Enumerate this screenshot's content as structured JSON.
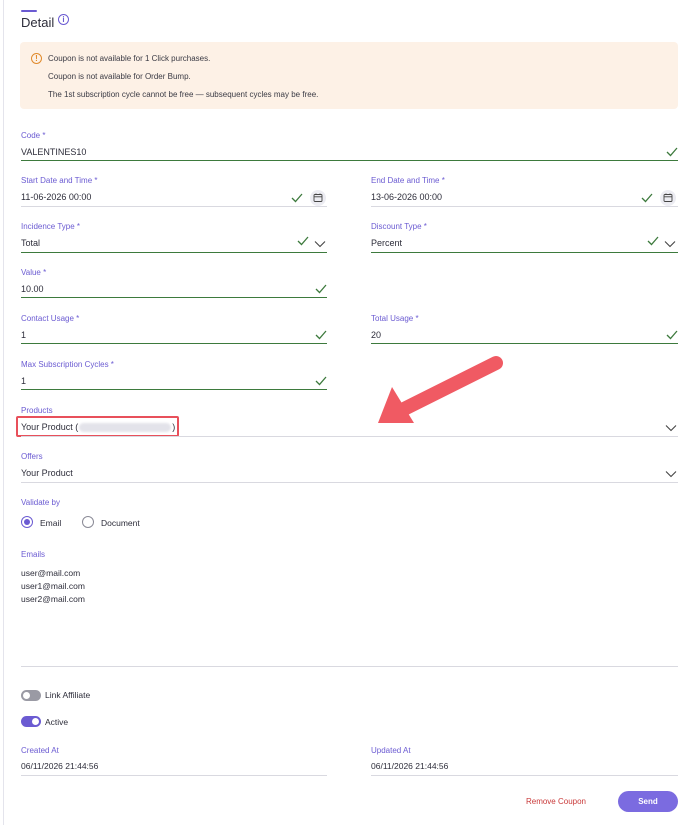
{
  "header": {
    "title": "Detail"
  },
  "alert": {
    "messages": [
      "Coupon is not available for 1 Click purchases.",
      "Coupon is not available for Order Bump.",
      "The 1st subscription cycle cannot be free — subsequent cycles may be free."
    ]
  },
  "form": {
    "code": {
      "label": "Code *",
      "value": "VALENTINES10"
    },
    "start": {
      "label": "Start Date and Time *",
      "value": "11-06-2026 00:00"
    },
    "end": {
      "label": "End Date and Time *",
      "value": "13-06-2026 00:00"
    },
    "incidence": {
      "label": "Incidence Type *",
      "value": "Total"
    },
    "discount": {
      "label": "Discount Type *",
      "value": "Percent"
    },
    "amount": {
      "label": "Value *",
      "value": "10.00"
    },
    "contact_usage": {
      "label": "Contact Usage *",
      "value": "1"
    },
    "total_usage": {
      "label": "Total Usage *",
      "value": "20"
    },
    "max_cycles": {
      "label": "Max Subscription Cycles *",
      "value": "1"
    },
    "products": {
      "label": "Products",
      "value_prefix": "Your Product (",
      "value_suffix": ")"
    },
    "offers": {
      "label": "Offers",
      "value": "Your Product"
    },
    "validate": {
      "label": "Validate by",
      "options": [
        "Email",
        "Document"
      ],
      "selected": "Email"
    },
    "emails": {
      "label": "Emails",
      "items": [
        "user@mail.com",
        "user1@mail.com",
        "user2@mail.com"
      ]
    },
    "link_affiliate": {
      "label": "Link Affiliate",
      "on": false
    },
    "active": {
      "label": "Active",
      "on": true
    },
    "created": {
      "label": "Created At",
      "value": "06/11/2026 21:44:56"
    },
    "updated": {
      "label": "Updated At",
      "value": "06/11/2026 21:44:56"
    }
  },
  "actions": {
    "remove_label": "Remove Coupon",
    "send_label": "Send"
  },
  "colors": {
    "accent": "#6b5bd2",
    "valid": "#3d7a3d",
    "danger": "#c93a3a",
    "alert_bg": "#fdf1e6",
    "highlight": "#e8505b"
  }
}
